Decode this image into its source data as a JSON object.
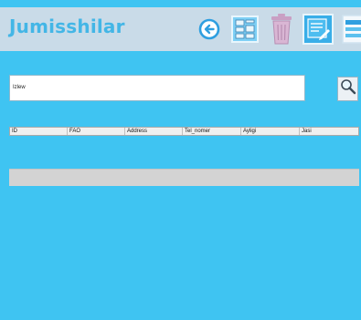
{
  "header": {
    "title": "Jumisshilar"
  },
  "toolbar": {
    "buttons": [
      {
        "name": "back-button",
        "icon": "back-arrow-icon"
      },
      {
        "name": "add-form-button",
        "icon": "form-document-icon"
      },
      {
        "name": "delete-button",
        "icon": "trash-icon"
      },
      {
        "name": "edit-button",
        "icon": "edit-note-icon"
      },
      {
        "name": "view-table-button",
        "icon": "table-view-icon"
      }
    ]
  },
  "search": {
    "value": "Izlew",
    "icon": "magnifier-icon"
  },
  "table": {
    "columns": [
      "ID",
      "FAO",
      "Address",
      "Tel_nomer",
      "Ayligi",
      "Jasi"
    ],
    "rows": []
  },
  "colors": {
    "background": "#3fc4f2",
    "header_bar": "#c9dbe8",
    "title": "#43b6e6",
    "icon_blue": "#2f9fe0"
  }
}
